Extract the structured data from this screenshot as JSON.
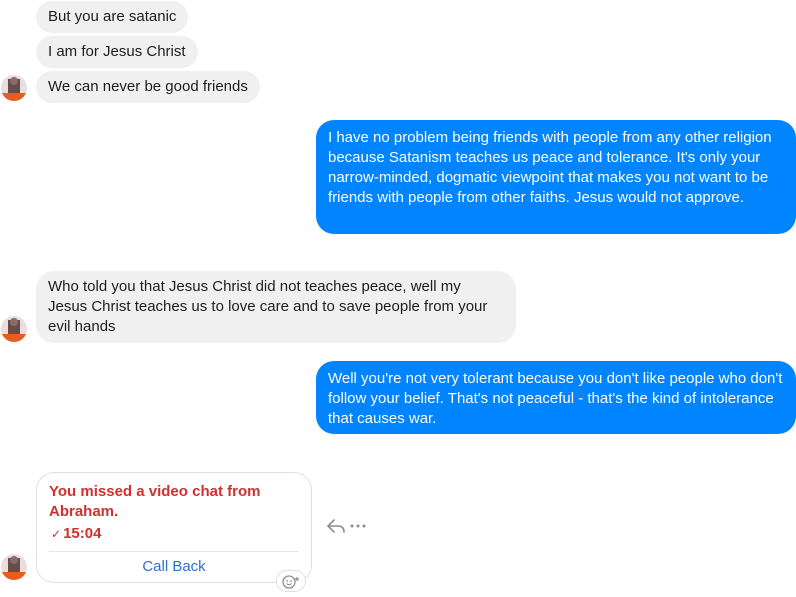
{
  "messages": {
    "in_1": "But you are satanic",
    "in_2": "I am for Jesus Christ",
    "in_3": "We can never be good friends",
    "out_1": "I have no problem being friends with people from any other religion because Satanism teaches us peace and tolerance. It's only your narrow-minded, dogmatic viewpoint that makes you not want to be friends with people from other faiths. Jesus would not approve.",
    "in_4": "Who told you that Jesus Christ did not teaches peace, well my Jesus Christ teaches us to love care and to save people from your evil hands",
    "out_2": "Well you're not very tolerant because you don't like people who don't follow your belief. That's not peaceful - that's the kind of intolerance that causes war."
  },
  "missed_call": {
    "title": "You missed a video chat from Abraham.",
    "time": "15:04",
    "action_label": "Call Back"
  },
  "colors": {
    "outgoing_bubble": "#0084ff",
    "incoming_bubble": "#f1f0f0",
    "missed_call_red": "#d0302f",
    "call_back_blue": "#2f6fcf"
  },
  "icons": [
    "avatar",
    "missed-call-check-icon",
    "reply-icon",
    "more-icon",
    "add-reaction-icon"
  ]
}
